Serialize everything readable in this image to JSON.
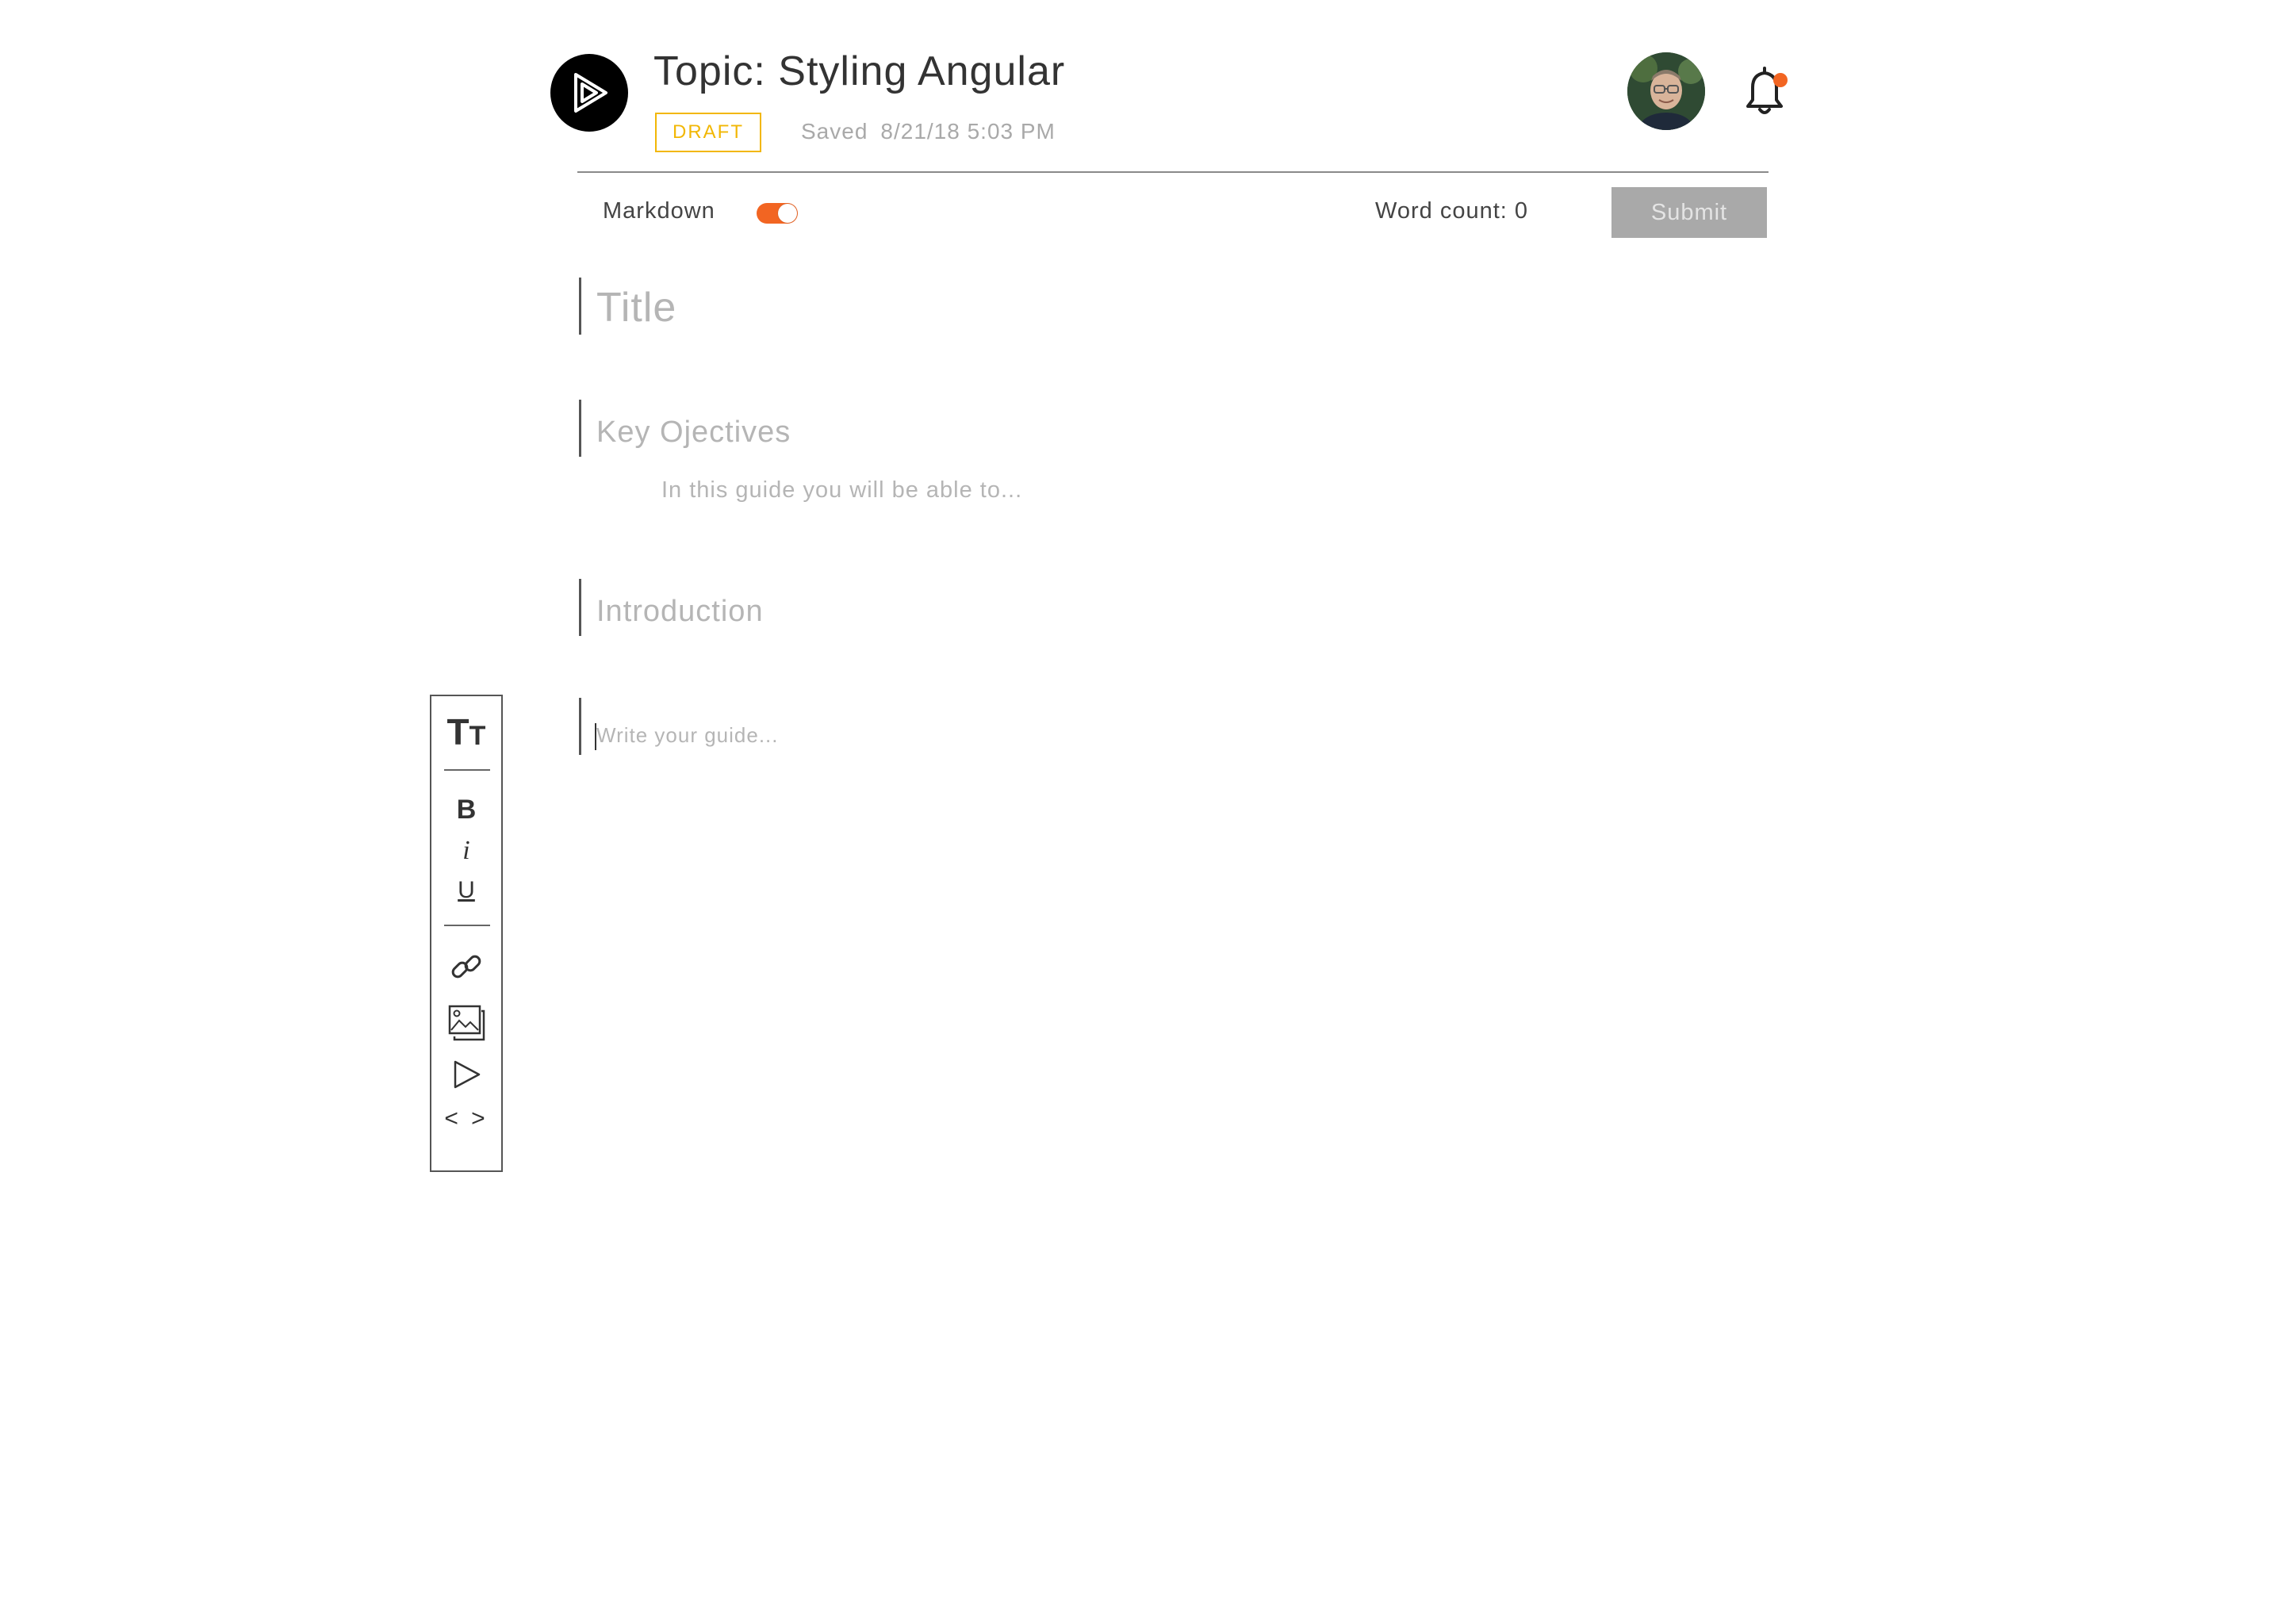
{
  "header": {
    "title": "Topic: Styling Angular",
    "status_badge": "DRAFT",
    "saved_label": "Saved",
    "saved_timestamp": "8/21/18 5:03 PM",
    "notification_dot_color": "#f26522"
  },
  "toolbar": {
    "markdown_label": "Markdown",
    "markdown_enabled": true,
    "word_count": "Word count: 0",
    "submit_label": "Submit"
  },
  "editor": {
    "title_placeholder": "Title",
    "objectives_placeholder": "Key Ojectives",
    "objectives_hint": "In this guide you will be able to...",
    "intro_placeholder": "Introduction",
    "body_placeholder": "Write your guide..."
  },
  "format_toolbar": {
    "text_size_label": "TT",
    "bold_label": "B",
    "italic_label": "i",
    "underline_label": "U",
    "code_label": "< >",
    "icons": [
      "text-size-icon",
      "bold-icon",
      "italic-icon",
      "underline-icon",
      "link-icon",
      "image-icon",
      "video-icon",
      "code-icon"
    ]
  },
  "colors": {
    "accent": "#f26522",
    "draft": "#f2b705",
    "submit_disabled": "#a9a9a9"
  }
}
